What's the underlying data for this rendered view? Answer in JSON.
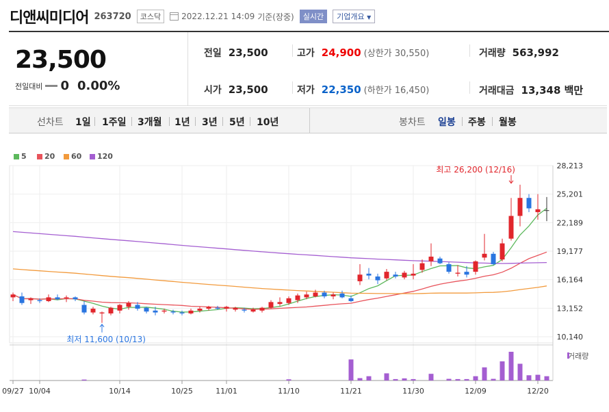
{
  "header": {
    "name": "디앤씨미디어",
    "code": "263720",
    "market": "코스닥",
    "datetime": "2022.12.21 14:09",
    "basis": "기준(장중)",
    "realtime": "실시간",
    "company_info": "기업개요"
  },
  "summary": {
    "price": "23,500",
    "change_label": "전일대비",
    "change_value": "0",
    "change_pct": "0.00%",
    "prev_close_label": "전일",
    "prev_close": "23,500",
    "high_label": "고가",
    "high": "24,900",
    "upper_limit": "(상한가 30,550)",
    "volume_label": "거래량",
    "volume": "563,992",
    "open_label": "시가",
    "open": "23,500",
    "low_label": "저가",
    "low": "22,350",
    "lower_limit": "(하한가 16,450)",
    "amount_label": "거래대금",
    "amount": "13,348 백만"
  },
  "toolbar": {
    "line_label": "선차트",
    "periods": [
      "1일",
      "1주일",
      "3개월",
      "1년",
      "3년",
      "5년",
      "10년"
    ],
    "candle_label": "봉차트",
    "candle_types": [
      "일봉",
      "주봉",
      "월봉"
    ],
    "selected_candle": "일봉"
  },
  "legend": [
    {
      "name": "5",
      "color": "#5cb85c"
    },
    {
      "name": "20",
      "color": "#e8535b"
    },
    {
      "name": "60",
      "color": "#f29a3c"
    },
    {
      "name": "120",
      "color": "#a45ed1"
    }
  ],
  "volume_legend": "거래량",
  "colors": {
    "up": "#e1262c",
    "down": "#2a75e0",
    "flat": "#333333"
  },
  "chart_data": {
    "type": "candlestick",
    "y_ticks": [
      "28,213",
      "25,201",
      "22,189",
      "19,177",
      "16,164",
      "13,152",
      "10,140"
    ],
    "ylim": [
      10140,
      28213
    ],
    "x_ticks": [
      {
        "label": "09/27",
        "index": 0
      },
      {
        "label": "10/04",
        "index": 3
      },
      {
        "label": "10/14",
        "index": 12
      },
      {
        "label": "10/25",
        "index": 19
      },
      {
        "label": "11/01",
        "index": 24
      },
      {
        "label": "11/10",
        "index": 31
      },
      {
        "label": "11/21",
        "index": 38
      },
      {
        "label": "11/30",
        "index": 45
      },
      {
        "label": "12/09",
        "index": 52
      },
      {
        "label": "12/20",
        "index": 59
      }
    ],
    "annotations": {
      "high": {
        "text": "최고 26,200 (12/16)",
        "value": 26200,
        "index": 56
      },
      "low": {
        "text": "최저 11,600 (10/13)",
        "value": 11600,
        "index": 10
      }
    },
    "candles": [
      [
        14300,
        14800,
        13900,
        14600
      ],
      [
        14400,
        14800,
        13500,
        13700
      ],
      [
        14000,
        14300,
        13600,
        14200
      ],
      [
        14000,
        14200,
        13700,
        13900
      ],
      [
        13900,
        14600,
        13800,
        14300
      ],
      [
        14300,
        14600,
        14000,
        14100
      ],
      [
        14200,
        14500,
        13800,
        14300
      ],
      [
        14300,
        14400,
        13900,
        14100
      ],
      [
        13500,
        13900,
        12500,
        12700
      ],
      [
        12700,
        13300,
        12500,
        13100
      ],
      [
        12600,
        12800,
        11600,
        12700
      ],
      [
        12600,
        13300,
        12400,
        13200
      ],
      [
        12900,
        13600,
        12600,
        13500
      ],
      [
        13300,
        13900,
        13000,
        13700
      ],
      [
        13500,
        13800,
        12900,
        13100
      ],
      [
        13200,
        13300,
        12600,
        12800
      ],
      [
        12900,
        13300,
        12400,
        12700
      ],
      [
        12800,
        13100,
        12600,
        12900
      ],
      [
        12800,
        13000,
        12500,
        12700
      ],
      [
        12700,
        12900,
        12400,
        12600
      ],
      [
        12600,
        13100,
        12500,
        12900
      ],
      [
        12900,
        13300,
        12700,
        13100
      ],
      [
        13100,
        13400,
        12900,
        13300
      ],
      [
        13200,
        13400,
        13000,
        13100
      ],
      [
        13100,
        13400,
        12800,
        13300
      ],
      [
        13000,
        13300,
        12800,
        13200
      ],
      [
        13000,
        13200,
        12700,
        12900
      ],
      [
        12800,
        13200,
        12700,
        13000
      ],
      [
        12900,
        13300,
        12700,
        13200
      ],
      [
        13200,
        14000,
        13100,
        13800
      ],
      [
        13600,
        14300,
        13400,
        13800
      ],
      [
        13700,
        14400,
        13500,
        14200
      ],
      [
        14000,
        14700,
        13700,
        14500
      ],
      [
        14300,
        14900,
        14100,
        14600
      ],
      [
        14400,
        15100,
        14300,
        14800
      ],
      [
        14800,
        15000,
        14200,
        14400
      ],
      [
        14400,
        14800,
        14100,
        14600
      ],
      [
        14700,
        15000,
        14200,
        14300
      ],
      [
        14200,
        14500,
        13800,
        13900
      ],
      [
        16000,
        17800,
        15600,
        16700
      ],
      [
        16800,
        17400,
        16200,
        16600
      ],
      [
        16500,
        16800,
        15700,
        16100
      ],
      [
        16300,
        17300,
        16100,
        17000
      ],
      [
        16700,
        17000,
        16300,
        16500
      ],
      [
        16400,
        17100,
        16200,
        16900
      ],
      [
        16600,
        17800,
        16200,
        16800
      ],
      [
        17200,
        18300,
        16900,
        17900
      ],
      [
        18100,
        20000,
        17600,
        18600
      ],
      [
        18400,
        18600,
        17800,
        17900
      ],
      [
        17800,
        18000,
        16800,
        17000
      ],
      [
        16800,
        17700,
        16500,
        16900
      ],
      [
        17000,
        17600,
        16400,
        16700
      ],
      [
        17000,
        18200,
        16700,
        18100
      ],
      [
        18500,
        21000,
        18200,
        18900
      ],
      [
        18900,
        19100,
        17700,
        17800
      ],
      [
        18300,
        20500,
        18100,
        20000
      ],
      [
        20500,
        24800,
        20300,
        22900
      ],
      [
        22900,
        26200,
        21800,
        24800
      ],
      [
        24800,
        25200,
        23300,
        23700
      ],
      [
        23300,
        25200,
        22500,
        23600
      ],
      [
        23500,
        24900,
        22350,
        23500
      ]
    ],
    "volume": [
      0,
      0,
      0,
      0,
      0,
      0,
      0,
      0,
      4,
      0,
      0,
      0,
      0,
      0,
      0,
      0,
      0,
      0,
      0,
      0,
      0,
      0,
      0,
      0,
      0,
      0,
      0,
      0,
      0,
      0,
      0,
      5,
      0,
      0,
      0,
      0,
      0,
      0,
      88,
      10,
      18,
      0,
      30,
      6,
      9,
      6,
      0,
      28,
      0,
      7,
      6,
      6,
      18,
      55,
      7,
      80,
      120,
      70,
      22,
      24,
      18
    ],
    "vol_max": 120
  }
}
